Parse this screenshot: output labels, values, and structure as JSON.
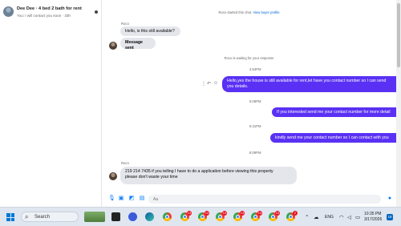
{
  "sidebar": {
    "chat": {
      "title": "Dee Dee · 4 bed 2 bath for rent",
      "subtitle": "You: I will contact you soon · 33h"
    }
  },
  "conversation": {
    "started_note": "Roco started this chat.",
    "started_link": "View buyer profile",
    "buyer_name": "Roco",
    "msg1": "Hello, is this still available?",
    "msg2": "Message sent",
    "waiting_note": "Roco is waiting for your response",
    "time1": "4:54PM",
    "out1_line1": "Hello,yes the house is still available for rent,let have you contact number so I can send",
    "out1_line2": "you details.",
    "time2": "5:08PM",
    "out2": "If you interested send me your contact number for more detail",
    "time3": "6:31PM",
    "out3": "kindly send me your contact number so I can contact with you",
    "time4": "8:09PM",
    "buyer_name2": "Roco",
    "in3_line1": "219 214 7435 if you telling I have to do a application before viewing this property",
    "in3_line2": "please don't waste your time"
  },
  "composer": {
    "placeholder": "Aa"
  },
  "taskbar": {
    "search_label": "Search",
    "lang": "ENG",
    "time": "10:35 PM",
    "date": "3/17/2026",
    "notifications": "18",
    "badges": [
      "",
      "13",
      "13",
      "13",
      "13",
      "13",
      "13",
      "2"
    ]
  },
  "colors": {
    "outgoing_bubble": "#5a31f4",
    "incoming_bubble": "#e4e6eb",
    "accent": "#0a7cff"
  }
}
